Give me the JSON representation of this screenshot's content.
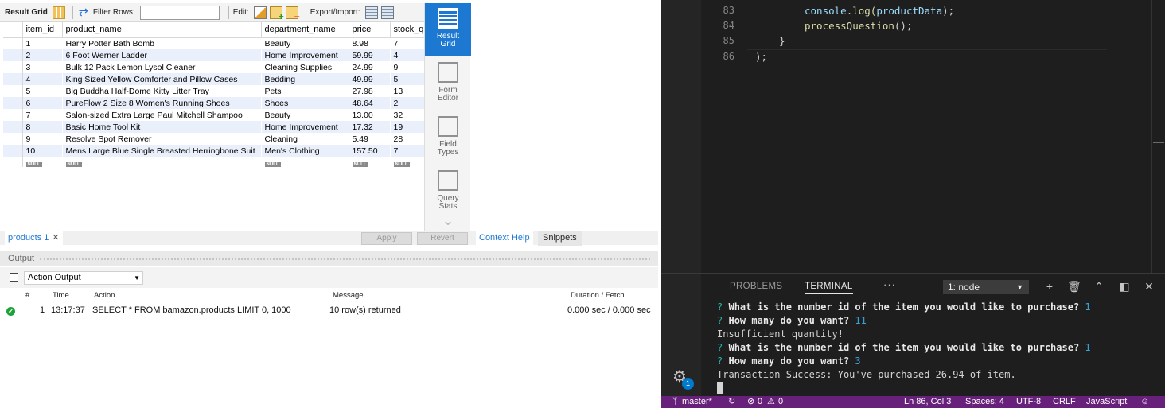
{
  "workbench": {
    "toolbar": {
      "result_grid_label": "Result Grid",
      "filter_rows_label": "Filter Rows:",
      "filter_value": "",
      "edit_label": "Edit:",
      "export_label": "Export/Import:"
    },
    "columns": [
      "item_id",
      "product_name",
      "department_name",
      "price",
      "stock_q"
    ],
    "rows": [
      [
        "1",
        "Harry Potter Bath Bomb",
        "Beauty",
        "8.98",
        "7"
      ],
      [
        "2",
        "6 Foot Werner Ladder",
        "Home Improvement",
        "59.99",
        "4"
      ],
      [
        "3",
        "Bulk 12 Pack Lemon Lysol Cleaner",
        "Cleaning Supplies",
        "24.99",
        "9"
      ],
      [
        "4",
        "King Sized Yellow Comforter and Pillow Cases",
        "Bedding",
        "49.99",
        "5"
      ],
      [
        "5",
        "Big Buddha Half-Dome Kitty Litter Tray",
        "Pets",
        "27.98",
        "13"
      ],
      [
        "6",
        "PureFlow 2 Size 8 Women's Running Shoes",
        "Shoes",
        "48.64",
        "2"
      ],
      [
        "7",
        "Salon-sized Extra Large Paul Mitchell Shampoo",
        "Beauty",
        "13.00",
        "32"
      ],
      [
        "8",
        "Basic Home Tool Kit",
        "Home Improvement",
        "17.32",
        "19"
      ],
      [
        "9",
        "Resolve Spot Remover",
        "Cleaning",
        "5.49",
        "28"
      ],
      [
        "10",
        "Mens Large Blue Single Breasted Herringbone Suit",
        "Men's Clothing",
        "157.50",
        "7"
      ]
    ],
    "null_label": "NULL",
    "sidebar": [
      {
        "line1": "Result",
        "line2": "Grid"
      },
      {
        "line1": "Form",
        "line2": "Editor"
      },
      {
        "line1": "Field",
        "line2": "Types"
      },
      {
        "line1": "Query",
        "line2": "Stats"
      }
    ],
    "result_tab": "products 1",
    "apply_label": "Apply",
    "revert_label": "Revert",
    "context_help_label": "Context Help",
    "snippets_label": "Snippets",
    "output": {
      "title": "Output",
      "selector": "Action Output",
      "headers": [
        "#",
        "Time",
        "Action",
        "Message",
        "Duration / Fetch"
      ],
      "row": {
        "num": "1",
        "time": "13:17:37",
        "action": "SELECT * FROM bamazon.products LIMIT 0, 1000",
        "message": "10 row(s) returned",
        "duration": "0.000 sec / 0.000 sec"
      }
    }
  },
  "editor": {
    "lines": [
      {
        "num": "83",
        "fn": "console",
        "rest": ".log(",
        "arg": "productData",
        "end": ");"
      },
      {
        "num": "84",
        "fn": "processQuestion",
        "rest": "();",
        "arg": "",
        "end": ""
      },
      {
        "num": "85",
        "text": "}"
      },
      {
        "num": "86",
        "text": ");"
      }
    ]
  },
  "panel": {
    "tabs": [
      "PROBLEMS",
      "TERMINAL"
    ],
    "more": "···",
    "terminal_select": "1: node",
    "terminal_lines": [
      {
        "q": "?",
        "text": "What is the number id of the item you would like to purchase?",
        "ans": "1"
      },
      {
        "q": "?",
        "text": "How many do you want?",
        "ans": "11"
      },
      {
        "q": "",
        "text": "Insufficient quantity!",
        "ans": ""
      },
      {
        "q": "?",
        "text": "What is the number id of the item you would like to purchase?",
        "ans": "1"
      },
      {
        "q": "?",
        "text": "How many do you want?",
        "ans": "3"
      },
      {
        "q": "",
        "text": "Transaction Success: You've purchased 26.94 of item.",
        "ans": ""
      }
    ],
    "badge": "1"
  },
  "statusbar": {
    "branch": "master*",
    "errors": "0",
    "warnings": "0",
    "position": "Ln 86, Col 3",
    "spaces": "Spaces: 4",
    "encoding": "UTF-8",
    "eol": "CRLF",
    "language": "JavaScript"
  },
  "colors": {
    "statusbar": "#68217a",
    "accent": "#1d78d1",
    "terminal_prompt": "#23b1a7"
  }
}
